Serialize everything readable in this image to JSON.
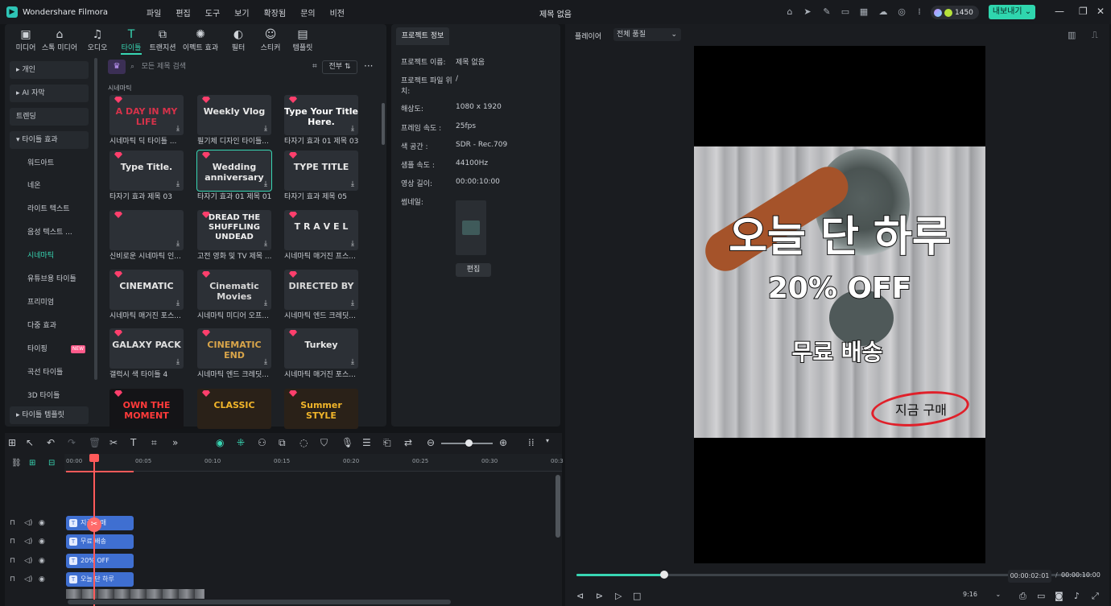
{
  "app": {
    "name": "Wondershare Filmora",
    "doc_title": "제목 없음",
    "menus": [
      "파일",
      "편집",
      "도구",
      "보기",
      "확장됨",
      "문의",
      "비전"
    ],
    "credits": "1450",
    "export_label": "내보내기"
  },
  "toolbar": [
    {
      "icon": "media-icon",
      "label": "미디어"
    },
    {
      "icon": "stock-media-icon",
      "label": "스톡 미디어"
    },
    {
      "icon": "audio-icon",
      "label": "오디오"
    },
    {
      "icon": "titles-icon",
      "label": "타이틀"
    },
    {
      "icon": "transition-icon",
      "label": "트랜지션"
    },
    {
      "icon": "effects-icon",
      "label": "이펙트 효과"
    },
    {
      "icon": "filter-icon",
      "label": "필터"
    },
    {
      "icon": "sticker-icon",
      "label": "스티커"
    },
    {
      "icon": "template-icon",
      "label": "템플릿"
    }
  ],
  "sidebar": [
    {
      "label": "개인"
    },
    {
      "label": "AI 자막"
    },
    {
      "label": "트렌딩"
    },
    {
      "label": "타이틀 효과"
    },
    {
      "label": "워드아트"
    },
    {
      "label": "네온"
    },
    {
      "label": "라이트 텍스트"
    },
    {
      "label": "음성 텍스트 ..."
    },
    {
      "label": "시네마틱"
    },
    {
      "label": "유튜브용 타이틀"
    },
    {
      "label": "프리미엄"
    },
    {
      "label": "다중 효과"
    },
    {
      "label": "타이핑",
      "badge": "NEW"
    },
    {
      "label": "곡선 타이틀"
    },
    {
      "label": "3D 타이틀"
    },
    {
      "label": "타이틀 템플릿"
    }
  ],
  "search": {
    "placeholder": "모든 제목 검색",
    "filter": "전부"
  },
  "category_label": "시네마틱",
  "titles": [
    {
      "thumb": "A DAY IN MY LIFE",
      "label": "시네마틱 딕 타이틀 ..."
    },
    {
      "thumb": "Weekly Vlog",
      "label": "필기체 디자인 타이틀..."
    },
    {
      "thumb": "Type Your Title Here.",
      "label": "타자기 효과 01 제목 03"
    },
    {
      "thumb": "Type Title.",
      "label": "타자기 효과 제목 03"
    },
    {
      "thumb": "Wedding anniversary",
      "label": "타자기 효과 01 제목 01"
    },
    {
      "thumb": "TYPE TITLE",
      "label": "타자기 효과 제목 05"
    },
    {
      "thumb": "",
      "label": "신비로운 시네마틱 인..."
    },
    {
      "thumb": "DREAD THE SHUFFLING UNDEAD",
      "label": "고전 영화 및 TV 제목 ..."
    },
    {
      "thumb": "T R A V E L",
      "label": "시네마틱 매거진 프스..."
    },
    {
      "thumb": "CINEMATIC",
      "label": "시네마틱 매거진 포스..."
    },
    {
      "thumb": "Cinematic Movies",
      "label": "시네마틱 미디어 오프..."
    },
    {
      "thumb": "DIRECTED BY",
      "label": "시네마틱 엔드 크레딧..."
    },
    {
      "thumb": "GALAXY PACK",
      "label": "갤럭시 색 타이틀 4"
    },
    {
      "thumb": "CINEMATIC END",
      "label": "시네마틱 엔드 크레딧..."
    },
    {
      "thumb": "Turkey",
      "label": "시네마틱 매거진 포스..."
    },
    {
      "thumb": "OWN THE MOMENT",
      "label": ""
    },
    {
      "thumb": "CLASSIC",
      "label": ""
    },
    {
      "thumb": "Summer STYLE",
      "label": ""
    }
  ],
  "project": {
    "tab": "프로젝트 정보",
    "rows": [
      {
        "k": "프로젝트 이름:",
        "v": "제목 없음"
      },
      {
        "k": "프로젝트 파일 위치:",
        "v": "/"
      },
      {
        "k": "해상도:",
        "v": "1080 x 1920"
      },
      {
        "k": "프레임 속도 :",
        "v": "25fps"
      },
      {
        "k": "색 공간 :",
        "v": "SDR - Rec.709"
      },
      {
        "k": "샘플 속도 :",
        "v": "44100Hz"
      },
      {
        "k": "영상 길이:",
        "v": "00:00:10:00"
      },
      {
        "k": "썸네일:",
        "v": ""
      }
    ],
    "edit": "편집"
  },
  "player": {
    "label": "플레이어",
    "quality": "전체 품질",
    "text1": "오늘 단 하루",
    "text2": "20% OFF",
    "text3": "무료 배송",
    "text4": "지금 구매",
    "current": "00:00:02:01",
    "total": "00:00:10:00",
    "ratio": "9:16",
    "progress": 0.17
  },
  "timeline": {
    "ticks": [
      "00:00",
      "00:05",
      "00:10",
      "00:15",
      "00:20",
      "00:25",
      "00:30",
      "00:3"
    ],
    "clips": [
      "지금 구매",
      "무료 배송",
      "20% OFF",
      "오늘 단 하루"
    ]
  }
}
